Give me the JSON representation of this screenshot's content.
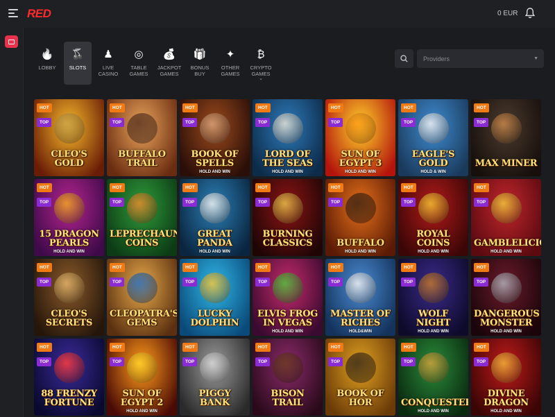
{
  "header": {
    "logo": "RED",
    "balance": "0 EUR"
  },
  "categories": [
    {
      "label": "LOBBY",
      "icon": "flame-icon",
      "active": false
    },
    {
      "label": "SLOTS",
      "icon": "cherries-icon",
      "active": true
    },
    {
      "label": "LIVE CASINO",
      "icon": "dealer-icon",
      "active": false
    },
    {
      "label": "TABLE GAMES",
      "icon": "roulette-icon",
      "active": false
    },
    {
      "label": "JACKPOT GAMES",
      "icon": "money-bag-icon",
      "active": false
    },
    {
      "label": "BONUS BUY",
      "icon": "gift-icon",
      "active": false
    },
    {
      "label": "OTHER GAMES",
      "icon": "orb-icon",
      "active": false
    },
    {
      "label": "CRYPTO GAMES",
      "icon": "crypto-coins-icon",
      "active": false
    }
  ],
  "filters": {
    "providers_placeholder": "Providers"
  },
  "badges": {
    "hot": "HOT",
    "top": "TOP"
  },
  "games": [
    {
      "title": "CLEO'S GOLD",
      "sub": "",
      "c1": "#f5b62a",
      "c2": "#6a1d05",
      "fig": "#caa14a"
    },
    {
      "title": "BUFFALO TRAIL",
      "sub": "",
      "c1": "#e9a35b",
      "c2": "#6a2c10",
      "fig": "#5a3320"
    },
    {
      "title": "BOOK OF SPELLS",
      "sub": "HOLD AND WIN",
      "c1": "#9b4a1c",
      "c2": "#2a0e08",
      "fig": "#d8a27a"
    },
    {
      "title": "LORD OF THE SEAS",
      "sub": "HOLD AND WIN",
      "c1": "#2d79b9",
      "c2": "#0d2c4a",
      "fig": "#e7e2d5"
    },
    {
      "title": "SUN OF EGYPT 3",
      "sub": "HOLD AND WIN",
      "c1": "#ffd12a",
      "c2": "#b3150c",
      "fig": "#ff9a1a"
    },
    {
      "title": "EAGLE'S GOLD",
      "sub": "HOLD & WIN",
      "c1": "#3f8bd0",
      "c2": "#1a3a5c",
      "fig": "#f2f2f2"
    },
    {
      "title": "MAX MINER",
      "sub": "",
      "c1": "#4a3a2e",
      "c2": "#160f0b",
      "fig": "#c9874a"
    },
    {
      "title": "15 DRAGON PEARLS",
      "sub": "HOLD AND WIN",
      "c1": "#b3248e",
      "c2": "#3f0a4a",
      "fig": "#f0a51d"
    },
    {
      "title": "LEPRECHAUN'S COINS",
      "sub": "",
      "c1": "#2f9a3a",
      "c2": "#0c3b15",
      "fig": "#e78a2c"
    },
    {
      "title": "GREAT PANDA",
      "sub": "HOLD AND WIN",
      "c1": "#2b7fb5",
      "c2": "#0a2540",
      "fig": "#f2f2f2"
    },
    {
      "title": "BURNING CLASSICS",
      "sub": "",
      "c1": "#8a1414",
      "c2": "#200505",
      "fig": "#e8c14a"
    },
    {
      "title": "BUFFALO",
      "sub": "HOLD AND WIN",
      "c1": "#e5701a",
      "c2": "#5a1a05",
      "fig": "#3b2313"
    },
    {
      "title": "ROYAL COINS",
      "sub": "HOLD AND WIN",
      "c1": "#b01a1a",
      "c2": "#3b0606",
      "fig": "#f3c231"
    },
    {
      "title": "GAMBLELICIOUS",
      "sub": "HOLD AND WIN",
      "c1": "#c0262c",
      "c2": "#5b0a10",
      "fig": "#f2c53a"
    },
    {
      "title": "CLEO'S SECRETS",
      "sub": "",
      "c1": "#8a5a2a",
      "c2": "#26160a",
      "fig": "#e2b46a"
    },
    {
      "title": "CLEOPATRA'S GEMS",
      "sub": "",
      "c1": "#e6a84a",
      "c2": "#5a3010",
      "fig": "#2a6fbf"
    },
    {
      "title": "LUCKY DOLPHIN",
      "sub": "",
      "c1": "#2fb6e6",
      "c2": "#0a4a7a",
      "fig": "#f2c53a"
    },
    {
      "title": "ELVIS FROG IN VEGAS",
      "sub": "HOLD AND WIN",
      "c1": "#c32a6a",
      "c2": "#3a0a30",
      "fig": "#4fc23a"
    },
    {
      "title": "MASTER OF RICHES",
      "sub": "HOLD&WIN",
      "c1": "#4a8ad0",
      "c2": "#13325c",
      "fig": "#f0f0f0"
    },
    {
      "title": "WOLF NIGHT",
      "sub": "HOLD AND WIN",
      "c1": "#3a2a8a",
      "c2": "#0d0a2a",
      "fig": "#c0772a"
    },
    {
      "title": "DANGEROUS MONSTER",
      "sub": "HOLD AND WIN",
      "c1": "#6a1a2a",
      "c2": "#1a050a",
      "fig": "#b0b0b8"
    },
    {
      "title": "88 FRENZY FORTUNE",
      "sub": "",
      "c1": "#3a2a9a",
      "c2": "#0a0a30",
      "fig": "#ff3a3a"
    },
    {
      "title": "SUN OF EGYPT 2",
      "sub": "HOLD AND WIN",
      "c1": "#ff9a1a",
      "c2": "#4a0a05",
      "fig": "#ffd12a"
    },
    {
      "title": "PIGGY BANK",
      "sub": "",
      "c1": "#9a9a9a",
      "c2": "#2a2a2a",
      "fig": "#d8d8d8"
    },
    {
      "title": "BISON TRAIL",
      "sub": "",
      "c1": "#8a2a6a",
      "c2": "#2a0a1a",
      "fig": "#6a3a20"
    },
    {
      "title": "BOOK OF HOR",
      "sub": "",
      "c1": "#e0a020",
      "c2": "#6a3a08",
      "fig": "#3a2a1a"
    },
    {
      "title": "CONQUESTERA",
      "sub": "HOLD AND WIN",
      "c1": "#2a8a3a",
      "c2": "#0a2a10",
      "fig": "#d0a03a"
    },
    {
      "title": "DIVINE DRAGON",
      "sub": "HOLD AND WIN",
      "c1": "#c01a1a",
      "c2": "#3a0505",
      "fig": "#f2b23a"
    }
  ],
  "top_badge_count": 28
}
